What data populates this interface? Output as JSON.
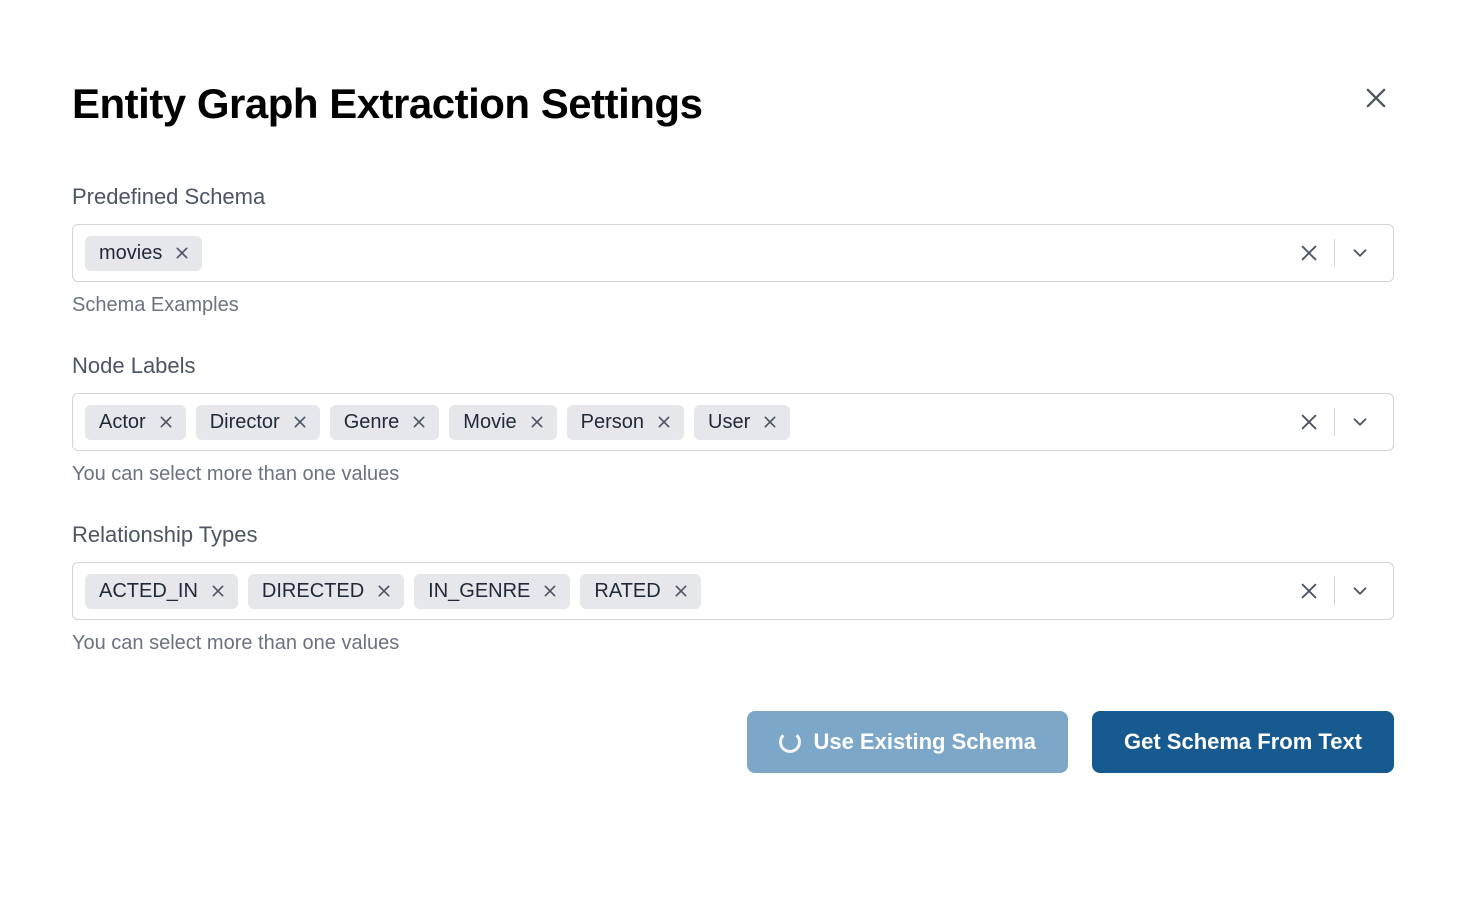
{
  "header": {
    "title": "Entity Graph Extraction Settings"
  },
  "predefined_schema": {
    "label": "Predefined Schema",
    "chips": [
      "movies"
    ],
    "helper": "Schema Examples"
  },
  "node_labels": {
    "label": "Node Labels",
    "chips": [
      "Actor",
      "Director",
      "Genre",
      "Movie",
      "Person",
      "User"
    ],
    "helper": "You can select more than one values"
  },
  "relationship_types": {
    "label": "Relationship Types",
    "chips": [
      "ACTED_IN",
      "DIRECTED",
      "IN_GENRE",
      "RATED"
    ],
    "helper": "You can select more than one values"
  },
  "actions": {
    "use_existing": "Use Existing Schema",
    "get_from_text": "Get Schema From Text"
  }
}
